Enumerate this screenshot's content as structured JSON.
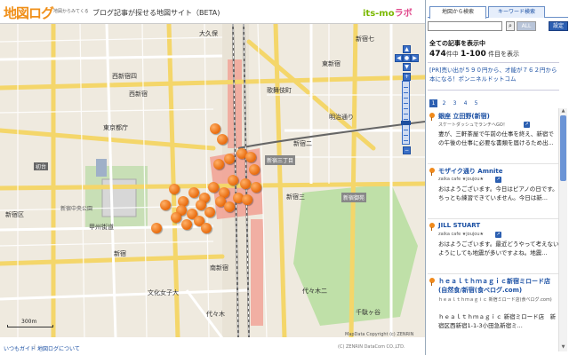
{
  "header": {
    "logo": "地図ログ",
    "logo_sub": "地図からみてくる",
    "tagline": "ブログ記事が探せる地図サイト（BETA)",
    "partner_left": "its-mo",
    "partner_right": "ラボ"
  },
  "map": {
    "labels": {
      "nishi_shinjuku": "西新宿",
      "nishi_shinjuku_4": "西新宿四",
      "hatsudai": "初台",
      "tokyo_opera": "東京都庁",
      "shinjuku_chuo_park": "新宿中央公園",
      "shinjuku_ku": "新宿区",
      "shinjuku": "新宿",
      "shinjuku_3": "新宿三",
      "shinjuku_gyoen": "新宿御苑",
      "bunka": "文化女子大",
      "yoyogi": "代々木",
      "minami_shinjuku": "南新宿",
      "kabukicho": "歌舞伎町",
      "okubo": "大久保",
      "shinjuku_sanchome": "新宿三丁目",
      "higashi_shinjuku": "東新宿",
      "area_east": "新宿七",
      "sendagaya": "千駄ヶ谷",
      "meiji": "明治通り",
      "yoyogi_2": "代々木二",
      "koshu_kaido": "甲州街道",
      "shinjuku_ni": "新宿二"
    },
    "scale_text": "300m",
    "copyright": "MapData Copyright (c) ZENRIN"
  },
  "footer": {
    "guide_link": "いつもガイド",
    "about_link": "地図ログについて",
    "copyright": "(C) ZENRIN DataCom CO.,LTD."
  },
  "sidebar": {
    "tab_map": "地図から検索",
    "tab_keyword": "キーワード検索",
    "search_placeholder": "",
    "all_button": "ALL",
    "settings_button": "設定",
    "count_title": "全ての記事を表示中",
    "count_total": "474",
    "count_unit": "件中",
    "count_range": "1-100",
    "count_suffix": "件目を表示",
    "ad_text": "[PR]売い出が５９０円から、才能が７６２円から本になる！ポンニネルドットコム",
    "pages": [
      "1",
      "2",
      "3",
      "4",
      "5"
    ],
    "results": [
      {
        "title": "銀座 立田野(新宿)",
        "blog": "スケートダッシュでランチへGO！",
        "excerpt": "妻が、三軒茶屋で午前の仕事を終え、新宿での午後の仕事に必要な書類を届けるため出..."
      },
      {
        "title": "モザイク通り Amnite",
        "blog": "zaika cafe ★joujou★",
        "excerpt": "おはようございます。今日はピアノの日です。ちっとも練習できていません。今日は新..."
      },
      {
        "title": "JILL STUART",
        "blog": "zaika cafe ★joujou★",
        "excerpt": "おはようございます。最近どうやって考えないようにしても地震が多いですよね。地震..."
      },
      {
        "title": "ｈｅａｌｔｈｍａｇｉｃ新宿ミロード店(自然食/新宿(食べログ.com)",
        "blog": "ｈｅａｌｔｈｍａｇｉｃ 新宿ミロード店(食べログ.com)",
        "excerpt": "ｈｅａｌｔｈｍａｇｉｃ 新宿ミロード店　新宿区西新宿1-1-3小田急新宿ミ..."
      }
    ]
  },
  "colors": {
    "accent": "#f0901a",
    "link": "#1a4fa3",
    "nav": "#3a6fc7",
    "pin": "#e86a0c"
  }
}
